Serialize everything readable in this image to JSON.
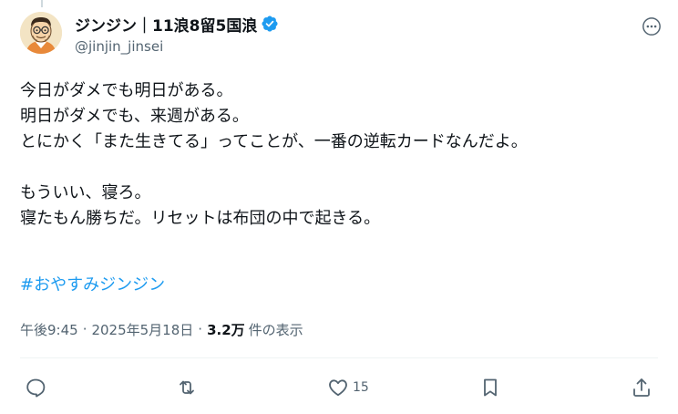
{
  "author": {
    "display_name": "ジンジン｜11浪8留5国浪",
    "handle": "@jinjin_jinsei",
    "verified": true,
    "avatar_icon": "cartoon-avatar-icon"
  },
  "tweet": {
    "body_lines": [
      "今日がダメでも明日がある。",
      "明日がダメでも、来週がある。",
      "とにかく「また生きてる」ってことが、一番の逆転カードなんだよ。",
      "",
      "もういい、寝ろ。",
      "寝たもん勝ちだ。リセットは布団の中で起きる。"
    ],
    "hashtag": "#おやすみジンジン"
  },
  "meta": {
    "time": "午後9:45",
    "separator": "·",
    "date": "2025年5月18日",
    "views_count": "3.2万",
    "views_label": "件の表示"
  },
  "actions": {
    "reply_icon": "reply-icon",
    "retweet_icon": "retweet-icon",
    "like_icon": "heart-icon",
    "like_count": "15",
    "bookmark_icon": "bookmark-icon",
    "share_icon": "share-icon"
  },
  "colors": {
    "text": "#0f1419",
    "secondary": "#536471",
    "link": "#1d9bf0",
    "verified": "#1d9bf0",
    "divider": "#eff3f4"
  }
}
